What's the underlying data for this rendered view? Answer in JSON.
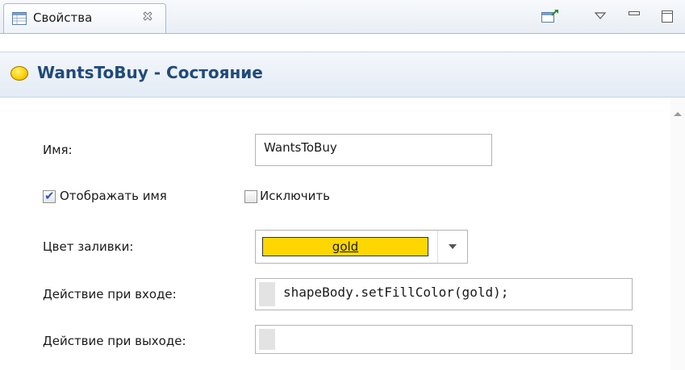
{
  "tab": {
    "label": "Свойства"
  },
  "header": {
    "title": "WantsToBuy - Состояние"
  },
  "form": {
    "name_label": "Имя:",
    "name_value": "WantsToBuy",
    "show_name_label": "Отображать имя",
    "show_name_checked": true,
    "exclude_label": "Исключить",
    "exclude_checked": false,
    "fill_color_label": "Цвет заливки:",
    "fill_color_value": "gold",
    "fill_color_hex": "#ffd700",
    "entry_action_label": "Действие при входе:",
    "entry_action_value": "shapeBody.setFillColor(gold);",
    "exit_action_label": "Действие при выходе:",
    "exit_action_value": ""
  },
  "icons": {
    "tab": "properties-icon",
    "tab_close": "close-icon",
    "pin": "pin-icon",
    "view_menu": "view-menu-icon",
    "minimize": "minimize-icon",
    "maximize": "maximize-icon",
    "state": "state-icon"
  }
}
